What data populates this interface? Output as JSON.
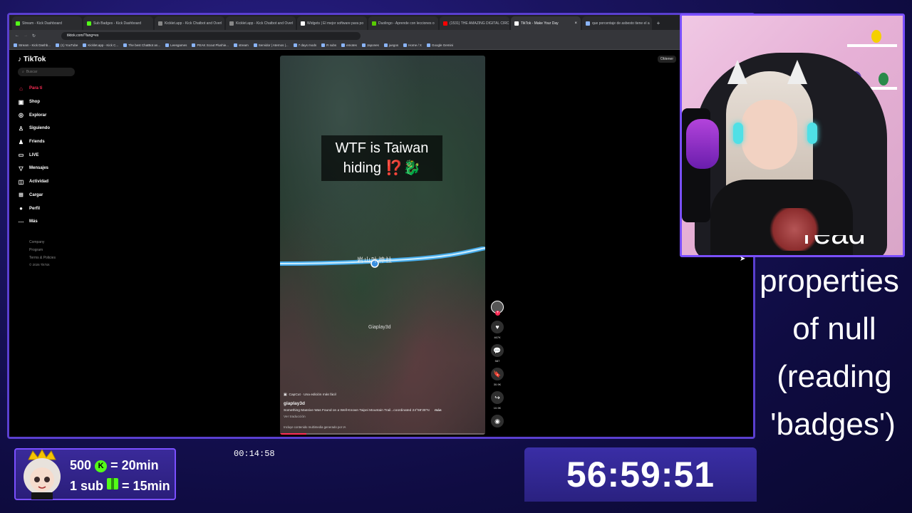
{
  "browser": {
    "tabs": [
      {
        "label": "Stream - Kick Dashboard",
        "color": "#53fc18"
      },
      {
        "label": "Sub Badges - Kick Dashboard",
        "color": "#53fc18"
      },
      {
        "label": "Kicklet.app - Kick Chatbot and Overl",
        "color": "#888888"
      },
      {
        "label": "Kicklet.app - Kick Chatbot and Overl",
        "color": "#888888"
      },
      {
        "label": "Widgets | El mejor software para po",
        "color": "#ffffff"
      },
      {
        "label": "Duolingo - Aprende con lecciones o",
        "color": "#58cc02"
      },
      {
        "label": "(1531) THE AMAZING DIGITAL CIRC",
        "color": "#ff0000"
      },
      {
        "label": "TikTok - Make Your Day",
        "color": "#ffffff",
        "active": true
      },
      {
        "label": "que porcentaje de asbesto tiene el a",
        "color": "#8ab4f8"
      }
    ],
    "url": "tiktok.com/?lang=es",
    "bookmarks": [
      "Stream - Kick Dashb...",
      "(1) YouTube",
      "Kicklet.app - Kick C...",
      "The best ChatBot an...",
      "Leesgames",
      "PEAK Scout Plushie...",
      "stream",
      "Servidor | Aternos |...",
      "7 days mods",
      "R subs",
      "emotes",
      "Japones",
      "juegos",
      "Home / X",
      "Google Gemini"
    ]
  },
  "tiktok": {
    "brand": "TikTok",
    "search_placeholder": "Buscar",
    "nav": [
      {
        "label": "Para ti",
        "icon": "home-icon",
        "glyph": "⌂",
        "active": true
      },
      {
        "label": "Shop",
        "icon": "shop-icon",
        "glyph": "▣"
      },
      {
        "label": "Explorar",
        "icon": "compass-icon",
        "glyph": "◎"
      },
      {
        "label": "Siguiendo",
        "icon": "following-icon",
        "glyph": "♙"
      },
      {
        "label": "Friends",
        "icon": "friends-icon",
        "glyph": "♟"
      },
      {
        "label": "LIVE",
        "icon": "live-icon",
        "glyph": "▭"
      },
      {
        "label": "Mensajes",
        "icon": "messages-icon",
        "glyph": "▽"
      },
      {
        "label": "Actividad",
        "icon": "activity-icon",
        "glyph": "◫"
      },
      {
        "label": "Cargar",
        "icon": "upload-icon",
        "glyph": "⊞"
      },
      {
        "label": "Perfil",
        "icon": "profile-icon",
        "glyph": "●"
      },
      {
        "label": "Más",
        "icon": "more-icon",
        "glyph": "⋯"
      }
    ],
    "footer": [
      "Company",
      "Program",
      "Terms & Policies"
    ],
    "copyright": "© 2026 TikTok",
    "get_app": "Obtener",
    "video": {
      "title_line1": "WTF is Taiwan",
      "title_line2": "hiding ⁉️🐉",
      "trail_label": "岩山叶神社",
      "watermark": "Giaplay3d",
      "capcut": "CapCut · Una edición más fácil",
      "author": "giaplay3d",
      "description": "Something Massive Was Found on a Well-Known Taipei Mountain Trail...coordinated 24°59'35\"N",
      "more": "más",
      "translate": "Ver traducción",
      "ai_notice": "Incluye contenido multimedia generado por IA",
      "progress": 0.13
    },
    "actions": [
      {
        "icon": "like-icon",
        "glyph": "♥",
        "count": "467K"
      },
      {
        "icon": "comment-icon",
        "glyph": "💬",
        "count": "587"
      },
      {
        "icon": "bookmark-icon",
        "glyph": "🔖",
        "count": "30.9K"
      },
      {
        "icon": "share-icon",
        "glyph": "↪",
        "count": "10.9K"
      }
    ]
  },
  "overlay": {
    "error_lines": [
      "read",
      "properties",
      "of null",
      "(reading",
      "'badges')"
    ],
    "sub_line1_a": "500",
    "sub_line1_b": "= 20min",
    "sub_line2_a": "1 sub",
    "sub_line2_b": "= 15min",
    "kick_coin": "K",
    "elapsed": "00:14:58",
    "countdown": "56:59:51"
  },
  "colors": {
    "accent": "#7a4fff",
    "tiktok_red": "#fe2c55",
    "kick_green": "#53fc18"
  }
}
